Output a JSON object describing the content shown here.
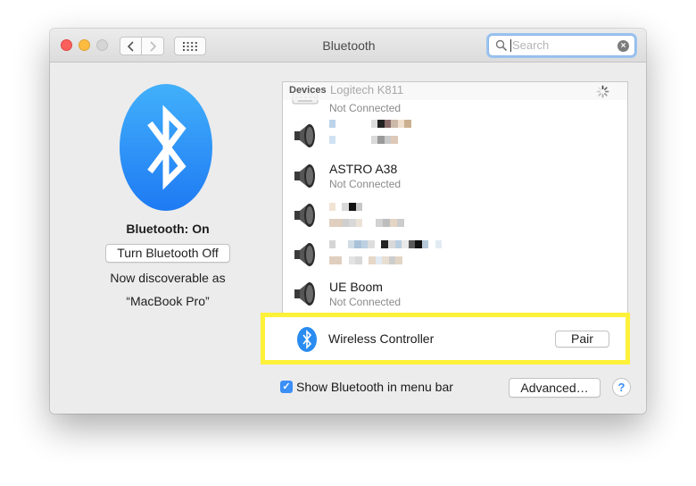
{
  "window": {
    "title": "Bluetooth"
  },
  "search": {
    "placeholder": "Search"
  },
  "sidebar": {
    "status": "Bluetooth: On",
    "toggle_label": "Turn Bluetooth Off",
    "discoverable_line1": "Now discoverable as",
    "discoverable_line2": "“MacBook Pro”"
  },
  "devices": {
    "header": "Devices",
    "items": [
      {
        "name": "Logitech K811",
        "status": "Not Connected",
        "icon": "keyboard-icon"
      },
      {
        "name": "",
        "status": "",
        "icon": "speaker-icon",
        "blurred": true
      },
      {
        "name": "ASTRO A38",
        "status": "Not Connected",
        "icon": "speaker-icon"
      },
      {
        "name": "",
        "status": "",
        "icon": "speaker-icon",
        "blurred": true
      },
      {
        "name": "",
        "status": "",
        "icon": "speaker-icon",
        "blurred": true
      },
      {
        "name": "UE Boom",
        "status": "Not Connected",
        "icon": "speaker-icon"
      }
    ],
    "pairing": {
      "name": "Wireless Controller",
      "icon": "bluetooth-icon",
      "button": "Pair"
    }
  },
  "footer": {
    "show_in_menu_bar": {
      "label": "Show Bluetooth in menu bar",
      "checked": true
    },
    "advanced_label": "Advanced…",
    "help_label": "?"
  },
  "colors": {
    "accent": "#3b8ff7",
    "highlight": "#fef139",
    "bluetooth_badge": "#2a8cf0"
  }
}
